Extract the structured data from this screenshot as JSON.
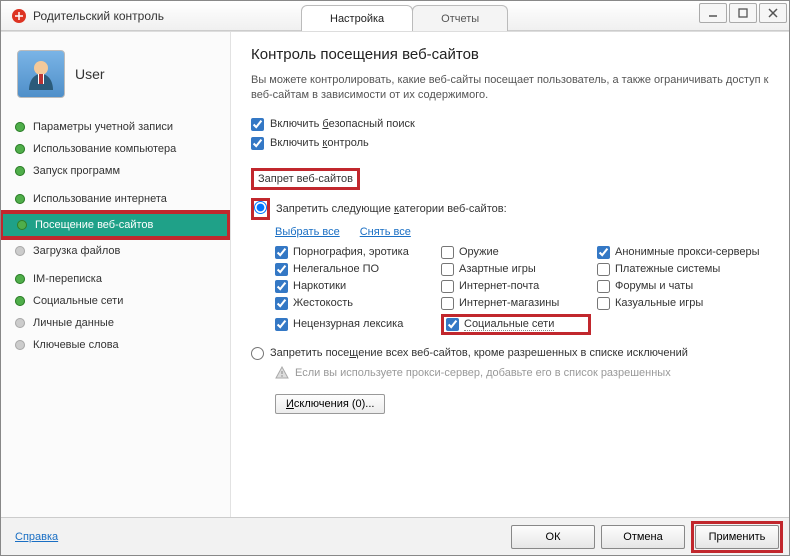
{
  "title": "Родительский контроль",
  "tabs": {
    "settings": "Настройка",
    "reports": "Отчеты"
  },
  "user": {
    "name": "User"
  },
  "sidebar": {
    "items": [
      {
        "label": "Параметры учетной записи",
        "on": true
      },
      {
        "label": "Использование компьютера",
        "on": true
      },
      {
        "label": "Запуск программ",
        "on": true
      },
      {
        "label": "Использование интернета",
        "on": true
      },
      {
        "label": "Посещение веб-сайтов",
        "on": true,
        "active": true
      },
      {
        "label": "Загрузка файлов",
        "on": false
      },
      {
        "label": "IM-переписка",
        "on": true
      },
      {
        "label": "Социальные сети",
        "on": true
      },
      {
        "label": "Личные данные",
        "on": false
      },
      {
        "label": "Ключевые слова",
        "on": false
      }
    ]
  },
  "main": {
    "heading": "Контроль посещения веб-сайтов",
    "description": "Вы можете контролировать, какие веб-сайты посещает пользователь, а также ограничивать доступ к веб-сайтам в зависимости от их содержимого.",
    "safe_search_pre": "Включить ",
    "safe_search_u": "б",
    "safe_search_post": "езопасный поиск",
    "enable_control_pre": "Включить ",
    "enable_control_u": "к",
    "enable_control_post": "онтроль",
    "section": "Запрет веб-сайтов",
    "radio1_pre": "Запретить следующие ",
    "radio1_u": "к",
    "radio1_post": "атегории веб-сайтов:",
    "select_all": "Выбрать все",
    "deselect_all": "Снять все",
    "categories": {
      "c00": "Порнография, эротика",
      "c01": "Оружие",
      "c02": "Анонимные прокси-серверы",
      "c10": "Нелегальное ПО",
      "c11": "Азартные игры",
      "c12": "Платежные системы",
      "c20": "Наркотики",
      "c21": "Интернет-почта",
      "c22": "Форумы и чаты",
      "c30": "Жестокость",
      "c31": "Интернет-магазины",
      "c32": "Казуальные игры",
      "c40": "Нецензурная лексика",
      "c41": "Социальные сети"
    },
    "radio2_pre": "Запретить посе",
    "radio2_u": "щ",
    "radio2_post": "ение всех веб-сайтов, кроме разрешенных в списке исключений",
    "proxy_note": "Если вы используете прокси-сервер, добавьте его в список разрешенных",
    "exceptions_pre": "И",
    "exceptions_post": "сключения (0)..."
  },
  "footer": {
    "help": "Справка",
    "ok": "ОК",
    "cancel": "Отмена",
    "apply": "Применить"
  }
}
